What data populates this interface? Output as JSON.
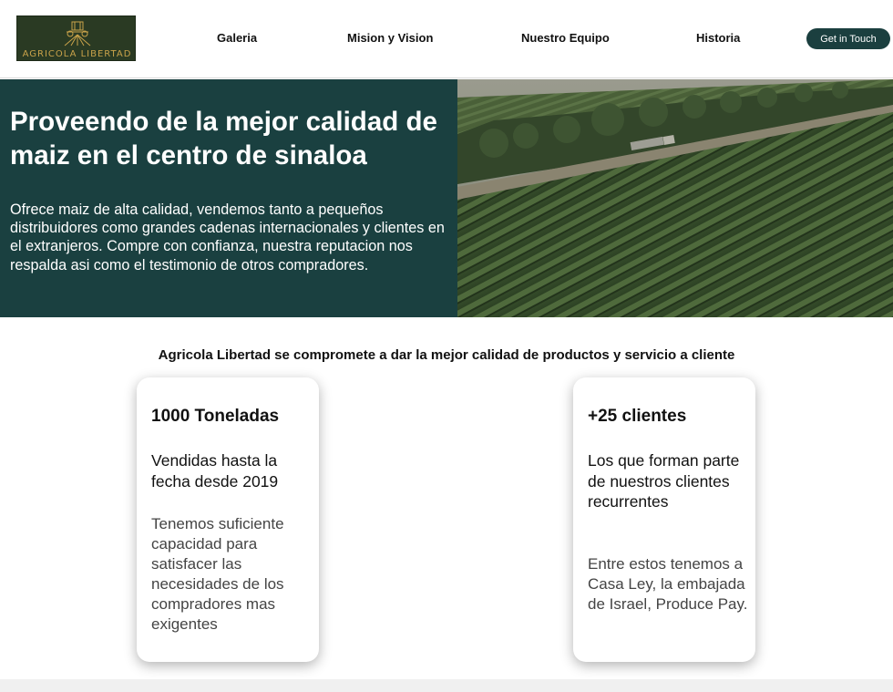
{
  "header": {
    "logo_text": "AGRICOLA LIBERTAD",
    "nav": [
      "Galeria",
      "Mision y Vision",
      "Nuestro Equipo",
      "Historia"
    ],
    "cta_label": "Get in Touch"
  },
  "hero": {
    "title": "Proveendo de la mejor calidad de maiz en el centro de sinaloa",
    "body": "Ofrece maiz de alta calidad, vendemos tanto a pequeños distribuidores como grandes cadenas internacionales y clientes en el extranjeros. Compre con confianza, nuestra reputacion nos respalda asi como el testimonio de otros compradores."
  },
  "tagline": "Agricola Libertad se compromete a dar la mejor calidad de productos y servicio a cliente",
  "cards": [
    {
      "title": "1000 Toneladas",
      "subtitle": "Vendidas hasta la fecha desde 2019",
      "description": "Tenemos suficiente capacidad para satisfacer las necesidades de los compradores mas exigentes"
    },
    {
      "title": "+25 clientes",
      "subtitle": "Los que forman parte de nuestros clientes recurrentes",
      "description": "Entre estos tenemos a Casa Ley, la embajada de Israel, Produce Pay."
    }
  ],
  "colors": {
    "brand_dark_green": "#1a4040",
    "cta_bg": "#1b3f3f",
    "logo_bg": "#2a3a23",
    "logo_gold": "#c8a24a"
  }
}
